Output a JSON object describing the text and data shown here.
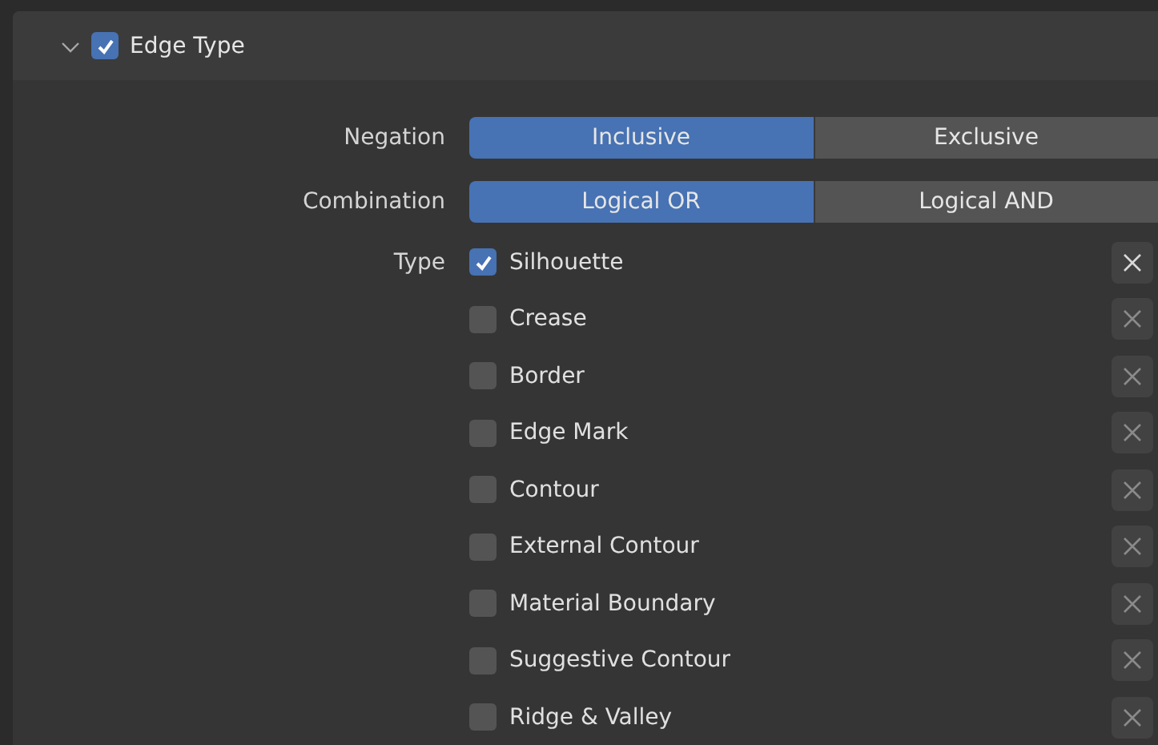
{
  "panel": {
    "title": "Edge Type",
    "expanded": true,
    "checked": true
  },
  "fields": [
    {
      "label": "Negation",
      "options": [
        {
          "label": "Inclusive",
          "selected": true
        },
        {
          "label": "Exclusive",
          "selected": false
        }
      ]
    },
    {
      "label": "Combination",
      "options": [
        {
          "label": "Logical OR",
          "selected": true
        },
        {
          "label": "Logical AND",
          "selected": false
        }
      ]
    }
  ],
  "type": {
    "label": "Type",
    "items": [
      {
        "label": "Silhouette",
        "checked": true,
        "exclude_disabled": false
      },
      {
        "label": "Crease",
        "checked": false,
        "exclude_disabled": true
      },
      {
        "label": "Border",
        "checked": false,
        "exclude_disabled": true
      },
      {
        "label": "Edge Mark",
        "checked": false,
        "exclude_disabled": true
      },
      {
        "label": "Contour",
        "checked": false,
        "exclude_disabled": true
      },
      {
        "label": "External Contour",
        "checked": false,
        "exclude_disabled": true
      },
      {
        "label": "Material Boundary",
        "checked": false,
        "exclude_disabled": true
      },
      {
        "label": "Suggestive Contour",
        "checked": false,
        "exclude_disabled": true
      },
      {
        "label": "Ridge & Valley",
        "checked": false,
        "exclude_disabled": true
      }
    ]
  }
}
